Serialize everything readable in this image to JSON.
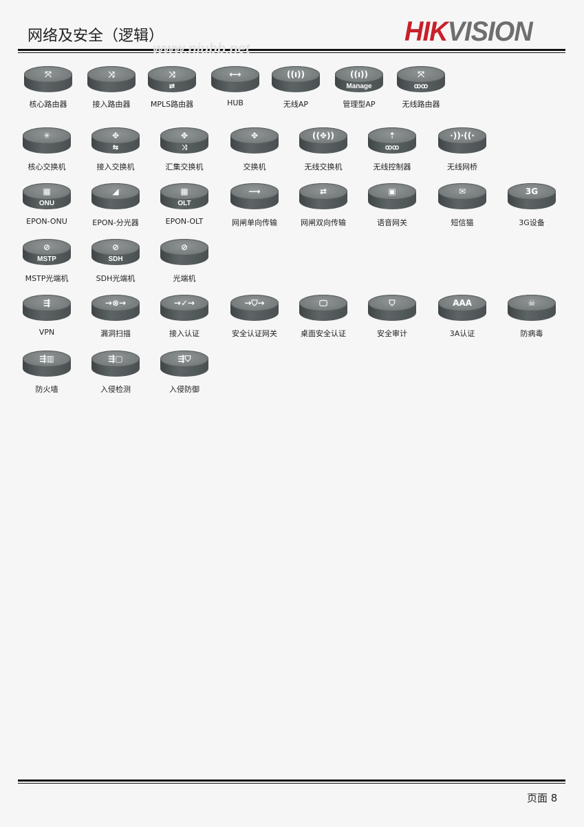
{
  "header": {
    "title": "网络及安全（逻辑）",
    "logo_hik": "HIK",
    "logo_vision": "VISION",
    "watermark": "www.niubb.net"
  },
  "rows": [
    [
      {
        "label": "核心路由器",
        "glyph": "⤧"
      },
      {
        "label": "接入路由器",
        "glyph": "⤨"
      },
      {
        "label": "MPLS路由器",
        "glyph": "⤨",
        "sub": "⇄"
      },
      {
        "label": "HUB",
        "glyph": "⟷"
      },
      {
        "label": "无线AP",
        "glyph": "((ı))"
      },
      {
        "label": "管理型AP",
        "glyph": "((ı))",
        "sub": "Manage"
      },
      {
        "label": "无线路由器",
        "glyph": "⤧",
        "sub": "ꝏꝏ"
      }
    ],
    [
      {
        "label": "核心交换机",
        "glyph": "✳"
      },
      {
        "label": "接入交换机",
        "glyph": "✥",
        "sub": "⇆"
      },
      {
        "label": "汇集交换机",
        "glyph": "✥",
        "sub": "⤨"
      },
      {
        "label": "交换机",
        "glyph": "✥"
      },
      {
        "label": "无线交换机",
        "glyph": "((✥))"
      },
      {
        "label": "无线控制器",
        "glyph": "⇡",
        "sub": "ꝏꝏ"
      },
      {
        "label": "无线网桥",
        "glyph": "·))·((·"
      }
    ],
    [
      {
        "label": "EPON-ONU",
        "glyph": "▦",
        "sub": "ONU"
      },
      {
        "label": "EPON-分光器",
        "glyph": "◢"
      },
      {
        "label": "EPON-OLT",
        "glyph": "▦",
        "sub": "OLT"
      },
      {
        "label": "网闸单向传输",
        "glyph": "⟶"
      },
      {
        "label": "网闸双向传输",
        "glyph": "⇄"
      },
      {
        "label": "语音网关",
        "glyph": "▣"
      },
      {
        "label": "短信猫",
        "glyph": "✉"
      },
      {
        "label": "3G设备",
        "glyph": "3G"
      }
    ],
    [
      {
        "label": "MSTP光端机",
        "glyph": "⊘",
        "sub": "MSTP"
      },
      {
        "label": "SDH光端机",
        "glyph": "⊘",
        "sub": "SDH"
      },
      {
        "label": "光端机",
        "glyph": "⊘"
      }
    ],
    [
      {
        "label": "VPN",
        "glyph": "⇶"
      },
      {
        "label": "漏洞扫描",
        "glyph": "→⊗→"
      },
      {
        "label": "接入认证",
        "glyph": "→✓→"
      },
      {
        "label": "安全认证网关",
        "glyph": "→⛉→"
      },
      {
        "label": "桌面安全认证",
        "glyph": "🖵"
      },
      {
        "label": "安全审计",
        "glyph": "⛉"
      },
      {
        "label": "3A认证",
        "glyph": "AAA"
      },
      {
        "label": "防病毒",
        "glyph": "☠"
      }
    ],
    [
      {
        "label": "防火墙",
        "glyph": "⇶▥"
      },
      {
        "label": "入侵检测",
        "glyph": "⇶▢"
      },
      {
        "label": "入侵防御",
        "glyph": "⇶⛉"
      }
    ]
  ],
  "footer": {
    "page_label": "页面 8"
  }
}
